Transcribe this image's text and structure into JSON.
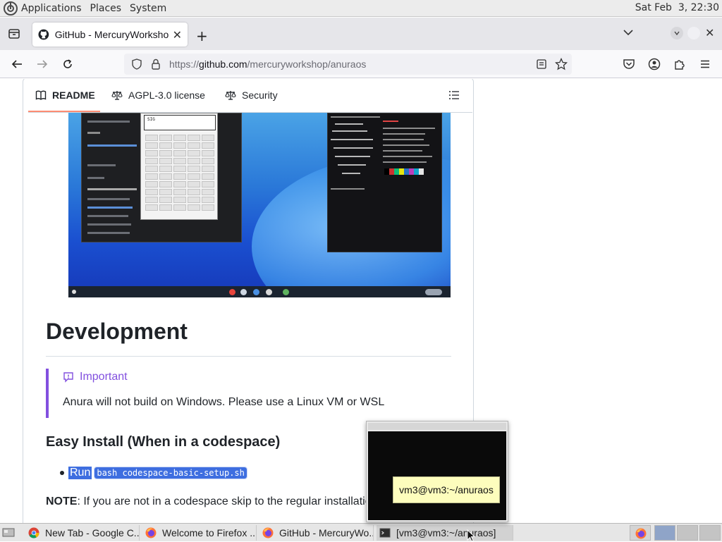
{
  "top_panel": {
    "menus": [
      "Applications",
      "Places",
      "System"
    ],
    "clock": "Sat Feb  3, 22:30"
  },
  "browser": {
    "tab_title": "GitHub - MercuryWorkshop/anuraos",
    "url_prefix": "https://",
    "url_host": "github.com",
    "url_path": "/mercuryworkshop/anuraos"
  },
  "readme_tabs": [
    {
      "label": "README",
      "icon": "book-icon"
    },
    {
      "label": "AGPL-3.0 license",
      "icon": "scale-icon"
    },
    {
      "label": "Security",
      "icon": "scale-icon"
    }
  ],
  "screenshot": {
    "calc_display": "SIG"
  },
  "content": {
    "heading_development": "Development",
    "alert_title": "Important",
    "alert_body": "Anura will not build on Windows. Please use a Linux VM or WSL",
    "heading_easy_install": "Easy Install (When in a codespace)",
    "bullet_run": "Run",
    "bullet_code": "bash codespace-basic-setup.sh",
    "note_label": "NOTE",
    "note_text": ": If you are not in a codespace skip to the regular installatio"
  },
  "preview_tooltip": "vm3@vm3:~/anuraos",
  "taskbar": {
    "tasks": [
      {
        "label": "New Tab - Google C...",
        "icon": "chrome-icon"
      },
      {
        "label": "Welcome to Firefox ...",
        "icon": "firefox-icon"
      },
      {
        "label": "GitHub - MercuryWo...",
        "icon": "firefox-icon"
      },
      {
        "label": "[vm3@vm3:~/anuraos]",
        "icon": "terminal-icon"
      }
    ]
  },
  "colors": {
    "accent_purple": "#8250df",
    "tab_underline": "#fd8c73",
    "selection": "#3e6ee0"
  }
}
